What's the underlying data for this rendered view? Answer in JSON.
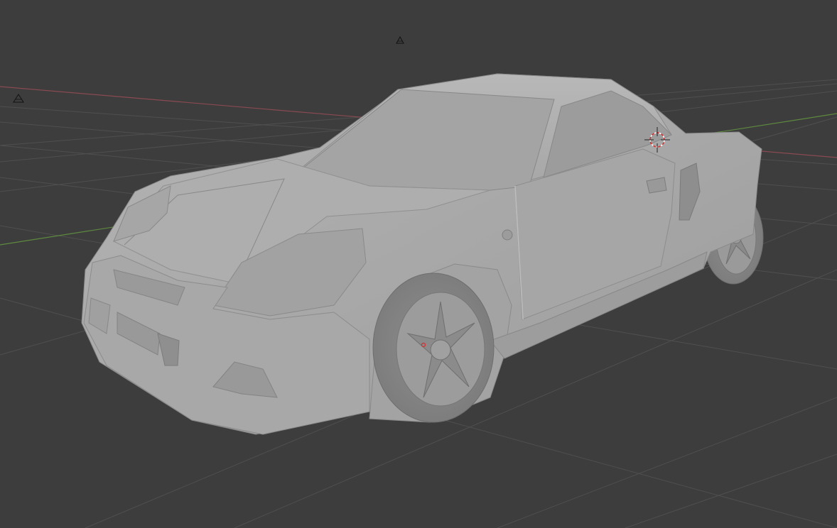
{
  "viewport": {
    "view": "perspective",
    "shading": "solid",
    "background_color": "#3d3d3d",
    "grid_color": "#4f4f4f",
    "x_axis_color": "#8a4a52",
    "y_axis_color": "#5e8a3f",
    "model_color": "#a9a9a9"
  },
  "objects": [
    {
      "name": "car-body-mesh",
      "icon": "car-mesh"
    },
    {
      "name": "light-object",
      "icon": "light-icon"
    },
    {
      "name": "camera-object",
      "icon": "camera-icon"
    }
  ],
  "cursor_3d": {
    "icon": "3d-cursor-icon"
  },
  "origin_marker": {
    "icon": "origin-dot-icon",
    "color": "#d03030"
  }
}
